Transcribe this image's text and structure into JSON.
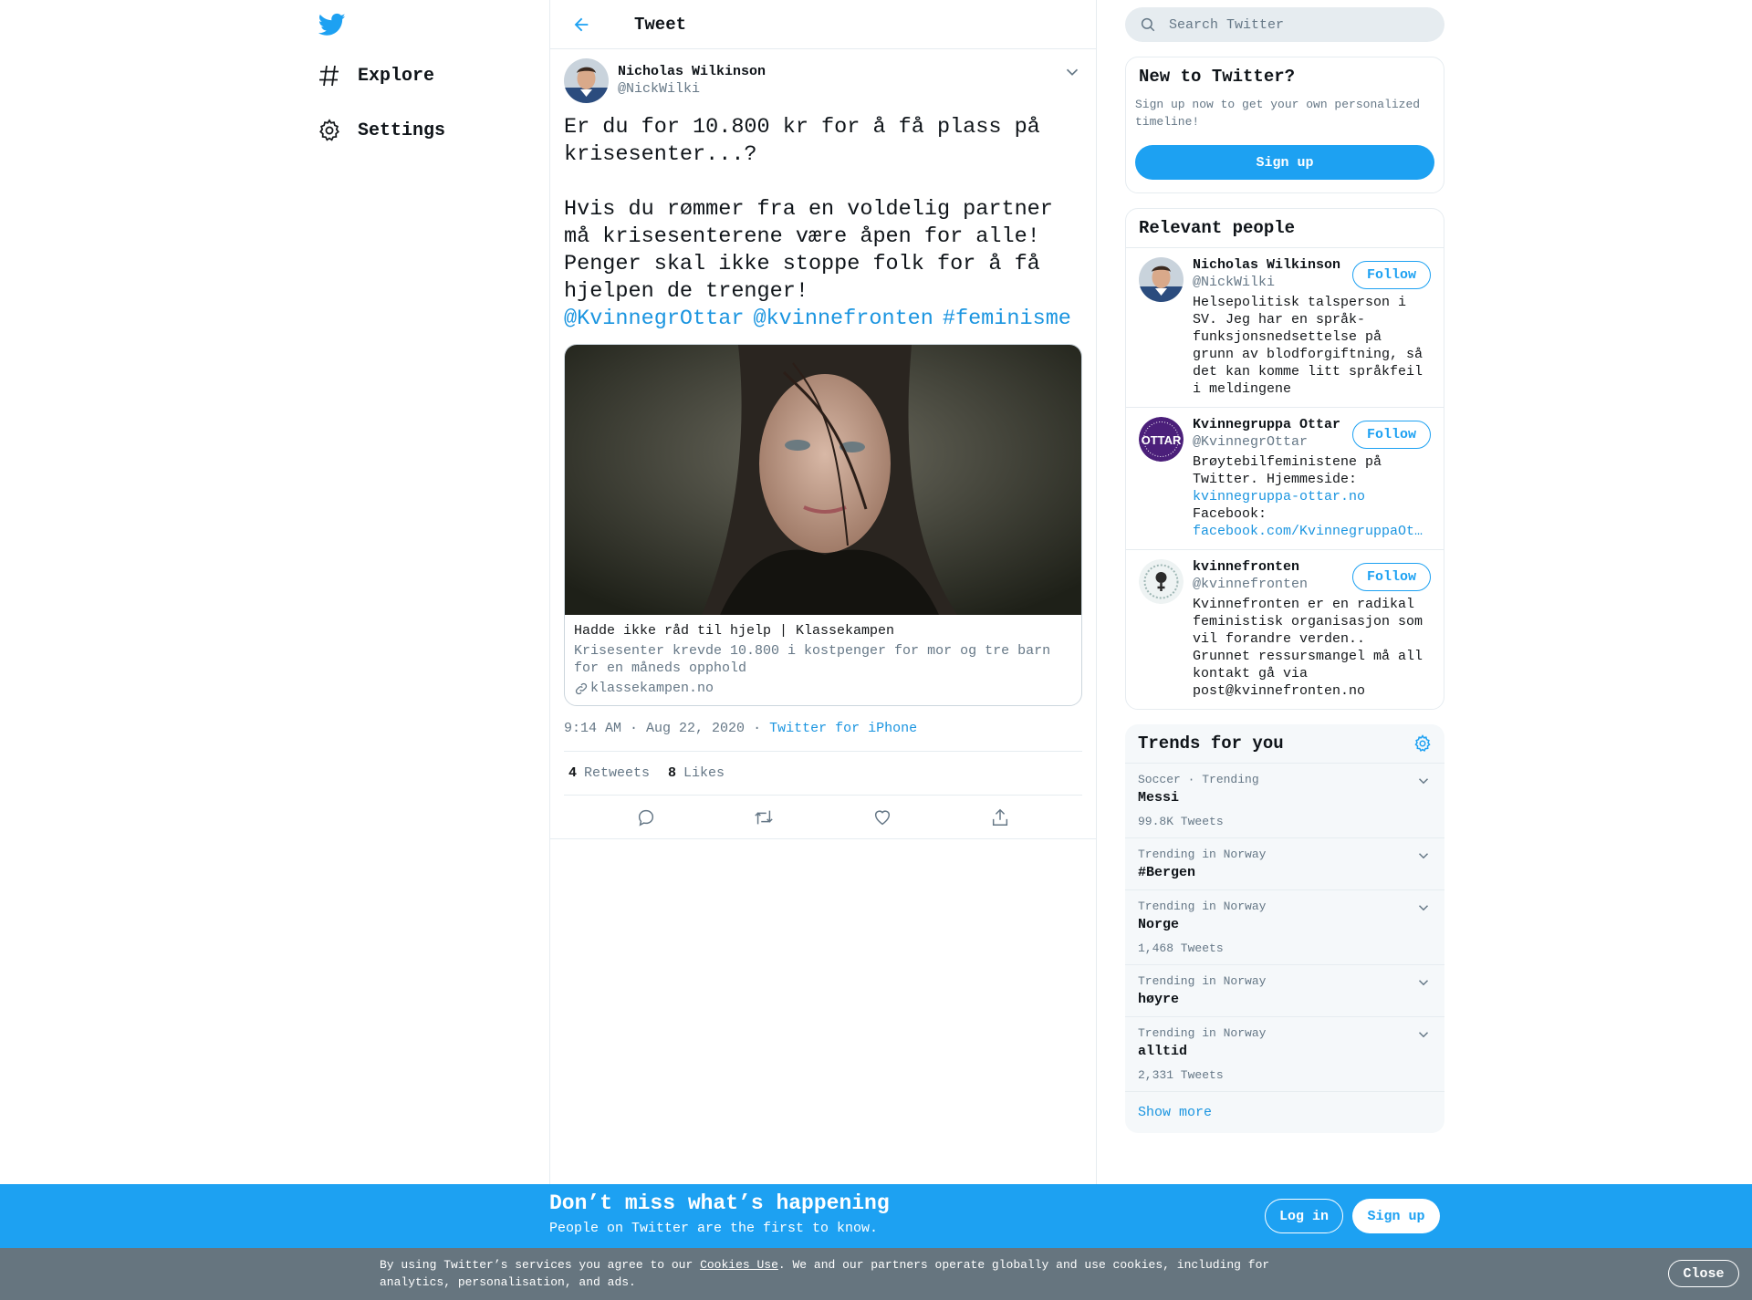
{
  "nav": {
    "items": [
      {
        "label": "Explore",
        "icon": "hashtag-icon"
      },
      {
        "label": "Settings",
        "icon": "gear-icon"
      }
    ]
  },
  "header": {
    "title": "Tweet"
  },
  "tweet": {
    "author": {
      "name": "Nicholas Wilkinson",
      "handle": "@NickWilki"
    },
    "text": "Er du for 10.800 kr for å få plass på krisesenter...?\n\nHvis du rømmer fra en voldelig partner må krisesenterene være åpen for alle! Penger skal ikke stoppe folk for å få hjelpen de trenger!",
    "mentions": [
      "@KvinnegrOttar",
      "@kvinnefronten",
      "#feminisme"
    ],
    "card": {
      "title": "Hadde ikke råd til hjelp | Klassekampen",
      "description": "Krisesenter krevde 10.800 i kostpenger for mor og tre barn for en måneds opphold",
      "domain": "klassekampen.no"
    },
    "time": "9:14 AM · Aug 22, 2020",
    "separator": "·",
    "source": "Twitter for iPhone",
    "retweets_count": "4",
    "retweets_label": "Retweets",
    "likes_count": "8",
    "likes_label": "Likes"
  },
  "search": {
    "placeholder": "Search Twitter"
  },
  "new_to_twitter": {
    "title": "New to Twitter?",
    "description": "Sign up now to get your own personalized timeline!",
    "button": "Sign up"
  },
  "relevant": {
    "title": "Relevant people",
    "people": [
      {
        "name": "Nicholas Wilkinson",
        "handle": "@NickWilki",
        "bio": "Helsepolitisk talsperson i SV. Jeg har en språk-funksjonsnedsettelse på grunn av blodforgiftning, så det kan komme litt språkfeil i meldingene",
        "follow": "Follow"
      },
      {
        "name": "Kvinnegruppa Ottar",
        "handle": "@KvinnegrOttar",
        "bio": "Brøytebilfeministene på Twitter. Hjemmeside:",
        "link1": "kvinnegruppa-ottar.no",
        "bio2": "Facebook:",
        "link2": "facebook.com/KvinnegruppaOt…",
        "follow": "Follow"
      },
      {
        "name": "kvinnefronten",
        "handle": "@kvinnefronten",
        "bio": "Kvinnefronten er en radikal feministisk organisasjon som vil forandre verden.. Grunnet ressursmangel må all kontakt gå via post@kvinnefronten.no",
        "follow": "Follow"
      }
    ]
  },
  "trends": {
    "title": "Trends for you",
    "items": [
      {
        "context": "Soccer · Trending",
        "name": "Messi",
        "count": "99.8K Tweets"
      },
      {
        "context": "Trending in Norway",
        "name": "#Bergen",
        "count": ""
      },
      {
        "context": "Trending in Norway",
        "name": "Norge",
        "count": "1,468 Tweets"
      },
      {
        "context": "Trending in Norway",
        "name": "høyre",
        "count": ""
      },
      {
        "context": "Trending in Norway",
        "name": "alltid",
        "count": "2,331 Tweets"
      }
    ],
    "show_more": "Show more"
  },
  "banner": {
    "title": "Don’t miss what’s happening",
    "subtitle": "People on Twitter are the first to know.",
    "login": "Log in",
    "signup": "Sign up"
  },
  "cookie": {
    "text_before": "By using Twitter’s services you agree to our ",
    "link": "Cookies Use",
    "text_after": ". We and our partners operate globally and use cookies, including for analytics, personalisation, and ads.",
    "close": "Close"
  },
  "colors": {
    "brand": "#1da1f2",
    "link": "#1b95e0",
    "secondary_text": "#657786",
    "border": "#e6ecf0",
    "cookie_bg": "#66757f"
  }
}
